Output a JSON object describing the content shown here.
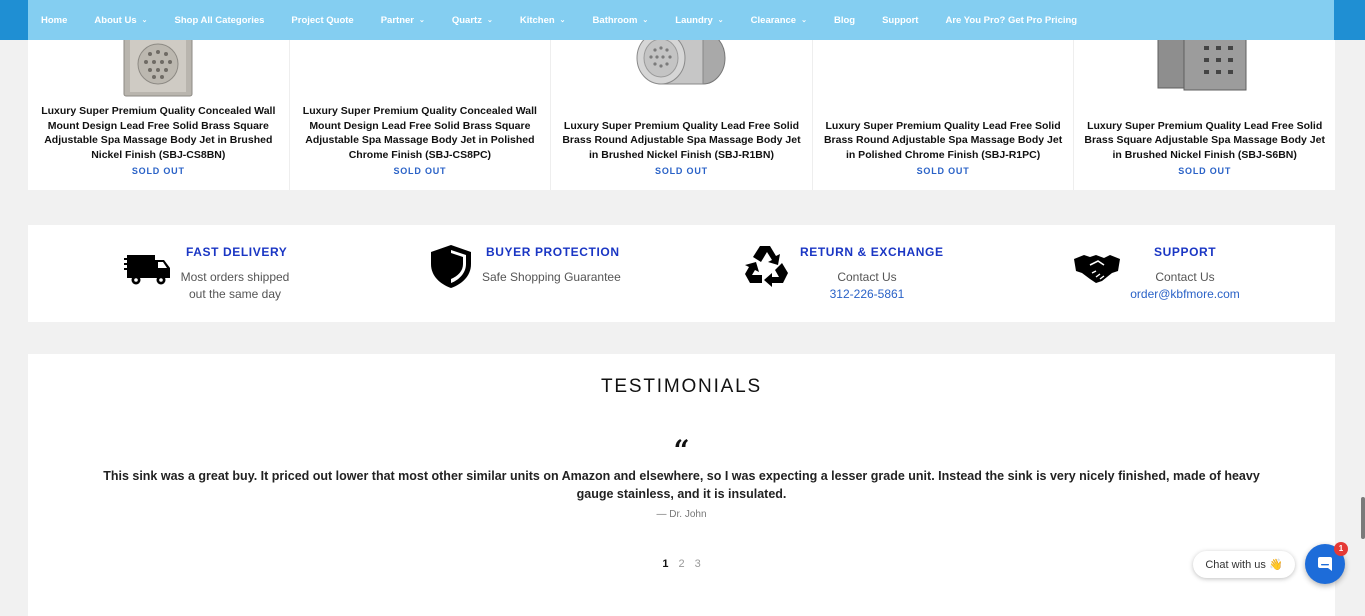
{
  "nav": {
    "items": [
      {
        "label": "Home",
        "dropdown": false
      },
      {
        "label": "About Us",
        "dropdown": true
      },
      {
        "label": "Shop All Categories",
        "dropdown": false
      },
      {
        "label": "Project Quote",
        "dropdown": false
      },
      {
        "label": "Partner",
        "dropdown": true
      },
      {
        "label": "Quartz",
        "dropdown": true
      },
      {
        "label": "Kitchen",
        "dropdown": true
      },
      {
        "label": "Bathroom",
        "dropdown": true
      },
      {
        "label": "Laundry",
        "dropdown": true
      },
      {
        "label": "Clearance",
        "dropdown": true
      },
      {
        "label": "Blog",
        "dropdown": false
      },
      {
        "label": "Support",
        "dropdown": false
      },
      {
        "label": "Are You Pro? Get Pro Pricing",
        "dropdown": false
      }
    ]
  },
  "products": [
    {
      "title": "Luxury Super Premium Quality Concealed Wall Mount Design Lead Free Solid Brass Square Adjustable Spa Massage Body Jet in Brushed Nickel Finish (SBJ-CS8BN)",
      "status": "SOLD OUT"
    },
    {
      "title": "Luxury Super Premium Quality Concealed Wall Mount Design Lead Free Solid Brass Square Adjustable Spa Massage Body Jet in Polished Chrome Finish (SBJ-CS8PC)",
      "status": "SOLD OUT"
    },
    {
      "title": "Luxury Super Premium Quality Lead Free Solid Brass Round Adjustable Spa Massage Body Jet in Brushed Nickel Finish (SBJ-R1BN)",
      "status": "SOLD OUT"
    },
    {
      "title": "Luxury Super Premium Quality Lead Free Solid Brass Round Adjustable Spa Massage Body Jet in Polished Chrome Finish (SBJ-R1PC)",
      "status": "SOLD OUT"
    },
    {
      "title": "Luxury Super Premium Quality Lead Free Solid Brass Square Adjustable Spa Massage Body Jet in Brushed Nickel Finish (SBJ-S6BN)",
      "status": "SOLD OUT"
    }
  ],
  "features": {
    "delivery": {
      "title": "FAST DELIVERY",
      "line1": "Most orders shipped",
      "line2": "out the same day",
      "icon": "delivery-truck-icon"
    },
    "protection": {
      "title": "BUYER PROTECTION",
      "line1": "Safe Shopping Guarantee",
      "icon": "shield-icon"
    },
    "returns": {
      "title": "RETURN & EXCHANGE",
      "line1": "Contact Us",
      "phone": "312-226-5861",
      "icon": "recycle-icon"
    },
    "support": {
      "title": "SUPPORT",
      "line1": "Contact Us",
      "email": "order@kbfmore.com",
      "icon": "handshake-icon"
    }
  },
  "testimonials": {
    "heading": "TESTIMONIALS",
    "quote_mark": "“",
    "text": "This sink was a great buy. It priced out lower that most other similar units on Amazon and elsewhere, so I was expecting a lesser grade unit. Instead the sink is very nicely finished, made of heavy gauge stainless, and it is insulated.",
    "author": "— Dr. John",
    "pages": [
      "1",
      "2",
      "3"
    ],
    "active_page": "1"
  },
  "chat": {
    "label": "Chat with us 👋",
    "badge": "1"
  },
  "colors": {
    "nav_bg": "#84cef1",
    "nav_outer": "#1f8fd3",
    "accent_blue": "#1a36c4",
    "link_blue": "#2a62c7",
    "chat_blue": "#1d6cd9"
  }
}
